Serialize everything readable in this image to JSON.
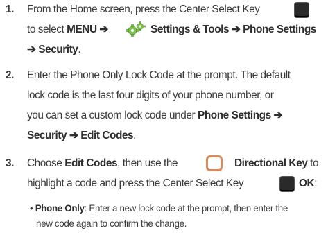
{
  "steps": [
    {
      "number": "1.",
      "l1_pre": "From the Home screen, press the Center Select Key",
      "l2_pre": "to select ",
      "l2_menu": "MENU",
      "l2_arrow1": " ➔ ",
      "l2_settings": "Settings & Tools ➔ Phone Settings",
      "l3": "➔ Security",
      "l3_end": "."
    },
    {
      "number": "2.",
      "l1": "Enter the Phone Only Lock Code at the prompt. The default",
      "l2": "lock code is the last four digits of your phone number, or",
      "l3_pre": "you can set a custom lock code under ",
      "l3_bold": "Phone Settings ➔",
      "l4_bold": "Security ➔ Edit Codes",
      "l4_end": "."
    },
    {
      "number": "3.",
      "l1_pre": "Choose ",
      "l1_bold": "Edit Codes",
      "l1_mid": ", then use the",
      "l1_dir": "Directional Key",
      "l1_end": " to",
      "l2_pre": "highlight a code and press the Center Select Key",
      "l2_ok": "OK",
      "l2_end": ":"
    }
  ],
  "bullet": {
    "label": "Phone Only",
    "text1": ": Enter a new lock code at the prompt, then enter the",
    "text2": "new code again to confirm the change."
  },
  "colors": {
    "key": "#2a2a2a",
    "dir_ring": "#d98a5a",
    "gear": "#7cc24a"
  }
}
